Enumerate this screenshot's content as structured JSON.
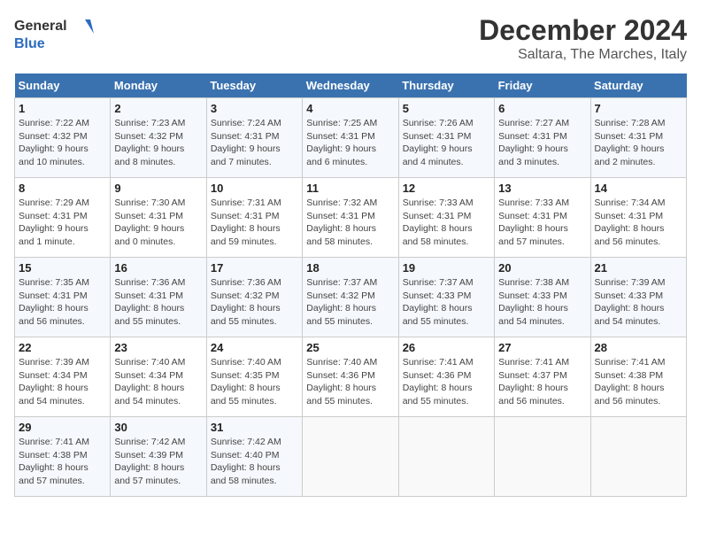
{
  "header": {
    "logo_line1": "General",
    "logo_line2": "Blue",
    "title": "December 2024",
    "subtitle": "Saltara, The Marches, Italy"
  },
  "calendar": {
    "days_of_week": [
      "Sunday",
      "Monday",
      "Tuesday",
      "Wednesday",
      "Thursday",
      "Friday",
      "Saturday"
    ],
    "weeks": [
      [
        {
          "day": "1",
          "info": "Sunrise: 7:22 AM\nSunset: 4:32 PM\nDaylight: 9 hours\nand 10 minutes."
        },
        {
          "day": "2",
          "info": "Sunrise: 7:23 AM\nSunset: 4:32 PM\nDaylight: 9 hours\nand 8 minutes."
        },
        {
          "day": "3",
          "info": "Sunrise: 7:24 AM\nSunset: 4:31 PM\nDaylight: 9 hours\nand 7 minutes."
        },
        {
          "day": "4",
          "info": "Sunrise: 7:25 AM\nSunset: 4:31 PM\nDaylight: 9 hours\nand 6 minutes."
        },
        {
          "day": "5",
          "info": "Sunrise: 7:26 AM\nSunset: 4:31 PM\nDaylight: 9 hours\nand 4 minutes."
        },
        {
          "day": "6",
          "info": "Sunrise: 7:27 AM\nSunset: 4:31 PM\nDaylight: 9 hours\nand 3 minutes."
        },
        {
          "day": "7",
          "info": "Sunrise: 7:28 AM\nSunset: 4:31 PM\nDaylight: 9 hours\nand 2 minutes."
        }
      ],
      [
        {
          "day": "8",
          "info": "Sunrise: 7:29 AM\nSunset: 4:31 PM\nDaylight: 9 hours\nand 1 minute."
        },
        {
          "day": "9",
          "info": "Sunrise: 7:30 AM\nSunset: 4:31 PM\nDaylight: 9 hours\nand 0 minutes."
        },
        {
          "day": "10",
          "info": "Sunrise: 7:31 AM\nSunset: 4:31 PM\nDaylight: 8 hours\nand 59 minutes."
        },
        {
          "day": "11",
          "info": "Sunrise: 7:32 AM\nSunset: 4:31 PM\nDaylight: 8 hours\nand 58 minutes."
        },
        {
          "day": "12",
          "info": "Sunrise: 7:33 AM\nSunset: 4:31 PM\nDaylight: 8 hours\nand 58 minutes."
        },
        {
          "day": "13",
          "info": "Sunrise: 7:33 AM\nSunset: 4:31 PM\nDaylight: 8 hours\nand 57 minutes."
        },
        {
          "day": "14",
          "info": "Sunrise: 7:34 AM\nSunset: 4:31 PM\nDaylight: 8 hours\nand 56 minutes."
        }
      ],
      [
        {
          "day": "15",
          "info": "Sunrise: 7:35 AM\nSunset: 4:31 PM\nDaylight: 8 hours\nand 56 minutes."
        },
        {
          "day": "16",
          "info": "Sunrise: 7:36 AM\nSunset: 4:31 PM\nDaylight: 8 hours\nand 55 minutes."
        },
        {
          "day": "17",
          "info": "Sunrise: 7:36 AM\nSunset: 4:32 PM\nDaylight: 8 hours\nand 55 minutes."
        },
        {
          "day": "18",
          "info": "Sunrise: 7:37 AM\nSunset: 4:32 PM\nDaylight: 8 hours\nand 55 minutes."
        },
        {
          "day": "19",
          "info": "Sunrise: 7:37 AM\nSunset: 4:33 PM\nDaylight: 8 hours\nand 55 minutes."
        },
        {
          "day": "20",
          "info": "Sunrise: 7:38 AM\nSunset: 4:33 PM\nDaylight: 8 hours\nand 54 minutes."
        },
        {
          "day": "21",
          "info": "Sunrise: 7:39 AM\nSunset: 4:33 PM\nDaylight: 8 hours\nand 54 minutes."
        }
      ],
      [
        {
          "day": "22",
          "info": "Sunrise: 7:39 AM\nSunset: 4:34 PM\nDaylight: 8 hours\nand 54 minutes."
        },
        {
          "day": "23",
          "info": "Sunrise: 7:40 AM\nSunset: 4:34 PM\nDaylight: 8 hours\nand 54 minutes."
        },
        {
          "day": "24",
          "info": "Sunrise: 7:40 AM\nSunset: 4:35 PM\nDaylight: 8 hours\nand 55 minutes."
        },
        {
          "day": "25",
          "info": "Sunrise: 7:40 AM\nSunset: 4:36 PM\nDaylight: 8 hours\nand 55 minutes."
        },
        {
          "day": "26",
          "info": "Sunrise: 7:41 AM\nSunset: 4:36 PM\nDaylight: 8 hours\nand 55 minutes."
        },
        {
          "day": "27",
          "info": "Sunrise: 7:41 AM\nSunset: 4:37 PM\nDaylight: 8 hours\nand 56 minutes."
        },
        {
          "day": "28",
          "info": "Sunrise: 7:41 AM\nSunset: 4:38 PM\nDaylight: 8 hours\nand 56 minutes."
        }
      ],
      [
        {
          "day": "29",
          "info": "Sunrise: 7:41 AM\nSunset: 4:38 PM\nDaylight: 8 hours\nand 57 minutes."
        },
        {
          "day": "30",
          "info": "Sunrise: 7:42 AM\nSunset: 4:39 PM\nDaylight: 8 hours\nand 57 minutes."
        },
        {
          "day": "31",
          "info": "Sunrise: 7:42 AM\nSunset: 4:40 PM\nDaylight: 8 hours\nand 58 minutes."
        },
        {
          "day": "",
          "info": ""
        },
        {
          "day": "",
          "info": ""
        },
        {
          "day": "",
          "info": ""
        },
        {
          "day": "",
          "info": ""
        }
      ]
    ]
  }
}
